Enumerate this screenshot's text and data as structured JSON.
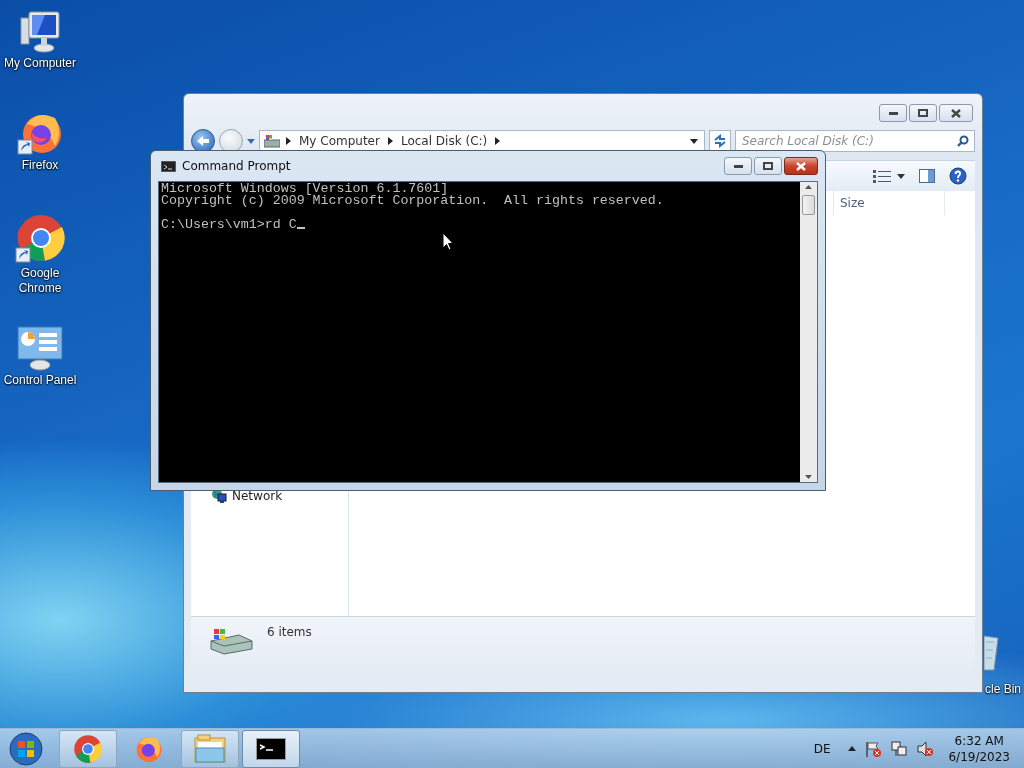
{
  "desktop_icons": [
    {
      "kind": "computer",
      "label": "My Computer"
    },
    {
      "kind": "firefox",
      "label": "Firefox"
    },
    {
      "kind": "chrome",
      "label": "Google Chrome"
    },
    {
      "kind": "control-panel",
      "label": "Control Panel"
    },
    {
      "kind": "recycle-bin",
      "label": "cle Bin"
    }
  ],
  "explorer": {
    "breadcrumbs": [
      "My Computer",
      "Local Disk (C:)"
    ],
    "search": {
      "placeholder": "Search Local Disk (C:)"
    },
    "columns": [
      "Size"
    ],
    "nav_items": [
      "Network"
    ],
    "status": "6 items"
  },
  "command_prompt": {
    "title": "Command Prompt",
    "output": [
      "Microsoft Windows [Version 6.1.7601]",
      "Copyright (c) 2009 Microsoft Corporation.  All rights reserved."
    ],
    "prompt": "C:\\Users\\vm1>rd C"
  },
  "taskbar": {
    "buttons": [
      {
        "kind": "chrome",
        "running": true
      },
      {
        "kind": "firefox",
        "running": false
      },
      {
        "kind": "explorer",
        "running": true
      },
      {
        "kind": "cmd",
        "running": true,
        "selected": true
      }
    ],
    "language": "DE",
    "time": "6:32 AM",
    "date": "6/19/2023"
  }
}
